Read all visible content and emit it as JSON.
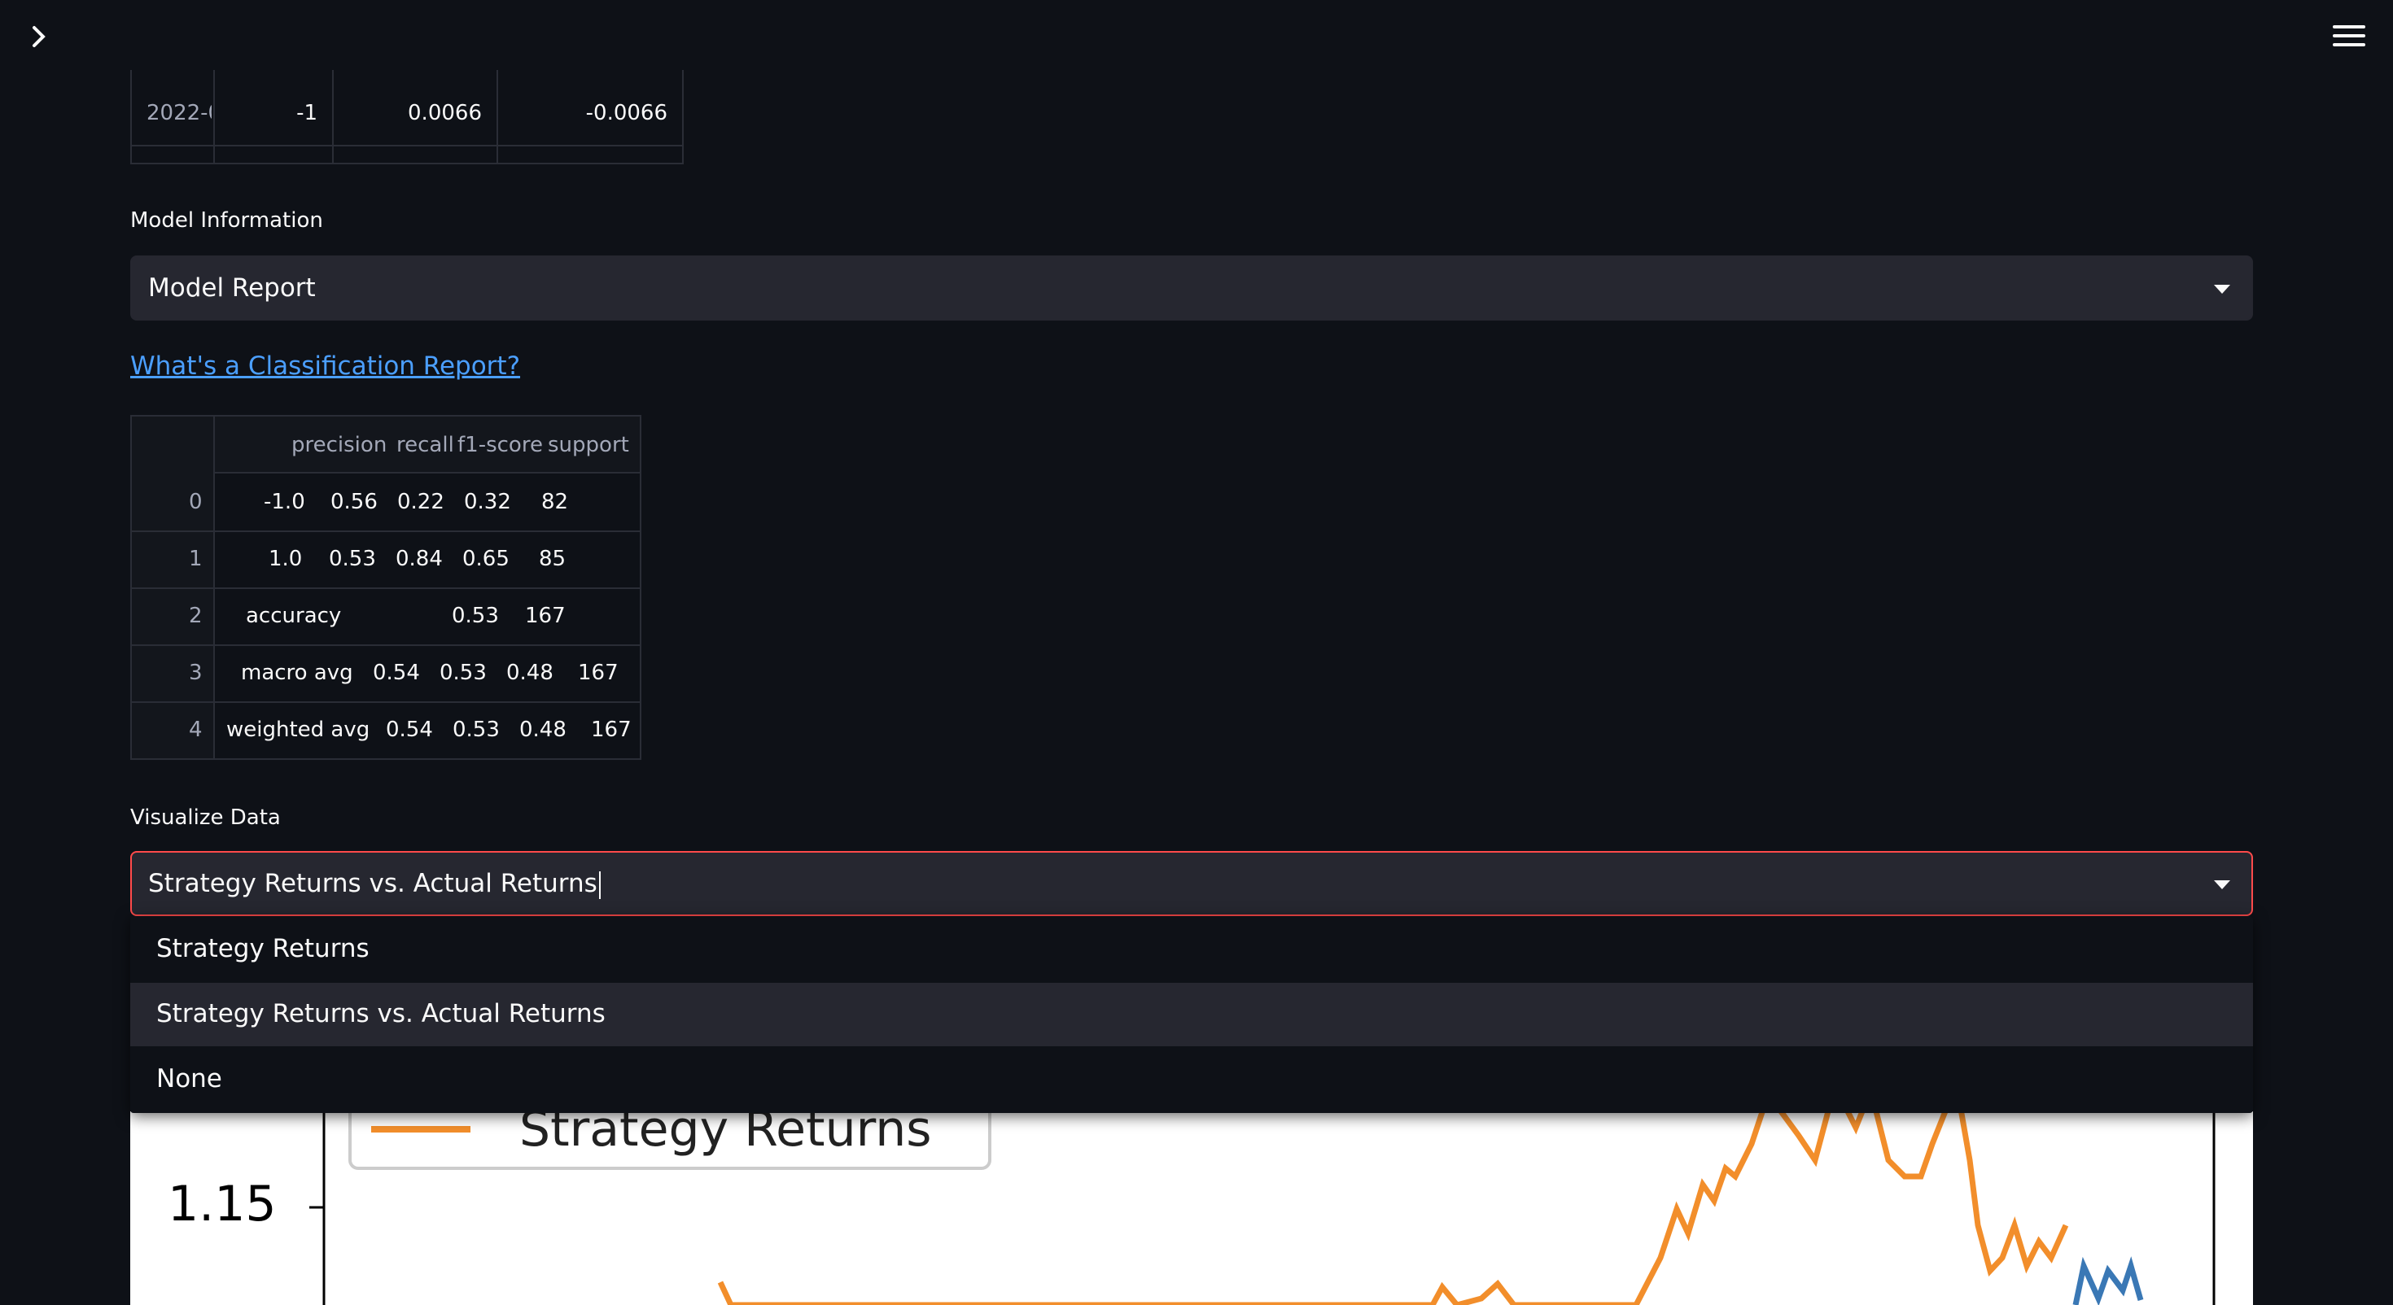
{
  "topbar": {
    "expand_icon": "chevron-right-icon",
    "menu_icon": "hamburger-menu-icon"
  },
  "top_table": {
    "cells": [
      "2022-0",
      "-1",
      "0.0066",
      "-0.0066"
    ]
  },
  "model_info": {
    "label": "Model Information",
    "select_value": "Model Report"
  },
  "report_link": "What's a Classification Report?",
  "report_table": {
    "columns": [
      "precision",
      "recall",
      "f1-score",
      "support"
    ],
    "rows": [
      {
        "index": "0",
        "cells": [
          "-1.0",
          "0.56",
          "0.22",
          "0.32",
          "82"
        ]
      },
      {
        "index": "1",
        "cells": [
          "1.0",
          "0.53",
          "0.84",
          "0.65",
          "85"
        ]
      },
      {
        "index": "2",
        "cells": [
          "accuracy",
          "0.53",
          "167"
        ]
      },
      {
        "index": "3",
        "cells": [
          "macro avg",
          "0.54",
          "0.53",
          "0.48",
          "167"
        ]
      },
      {
        "index": "4",
        "cells": [
          "weighted avg",
          "0.54",
          "0.53",
          "0.48",
          "167"
        ]
      }
    ]
  },
  "visualize": {
    "label": "Visualize Data",
    "select_value": "Strategy Returns vs. Actual Returns",
    "options": [
      "Strategy Returns",
      "Strategy Returns vs. Actual Returns",
      "None"
    ],
    "active_option": 1
  },
  "chart": {
    "legend_label": "Strategy Returns",
    "y_tick": "1.15",
    "colors": {
      "strategy": "#f28e2b",
      "actual": "#3a78b5"
    }
  }
}
